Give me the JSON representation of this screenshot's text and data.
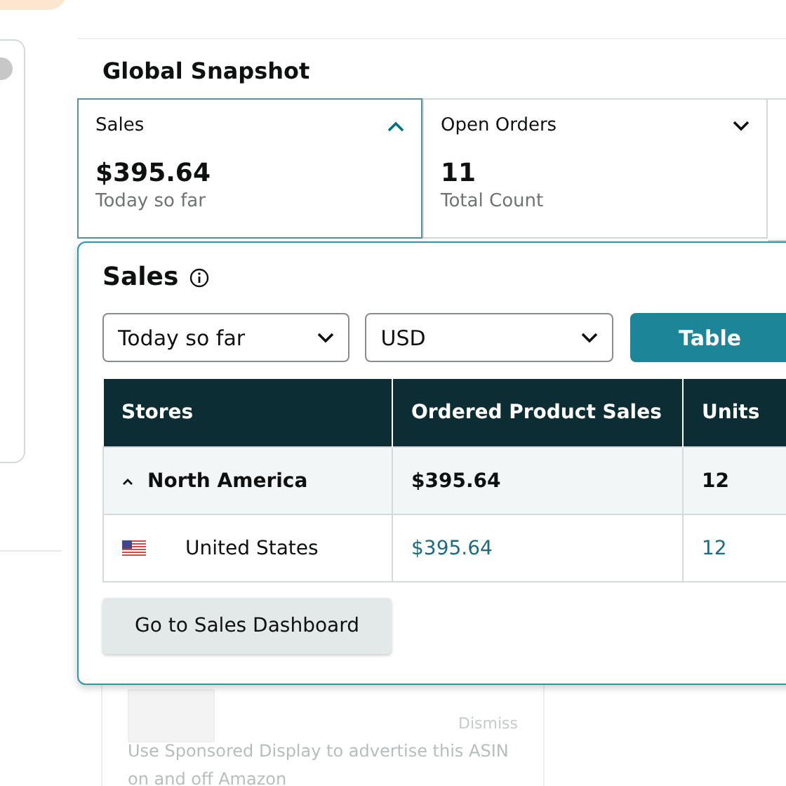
{
  "panel": {
    "title": "Global Snapshot"
  },
  "tiles": [
    {
      "label": "Sales",
      "value": "$395.64",
      "caption": "Today so far",
      "expanded": true
    },
    {
      "label": "Open Orders",
      "value": "11",
      "caption": "Total Count",
      "expanded": false
    }
  ],
  "popover": {
    "title": "Sales",
    "filters": [
      {
        "value": "Today so far"
      },
      {
        "value": "USD"
      }
    ],
    "view_button": "Table",
    "table": {
      "columns": [
        "Stores",
        "Ordered Product Sales",
        "Units"
      ],
      "rows": [
        {
          "kind": "group",
          "expanded": true,
          "cells": [
            "North America",
            "$395.64",
            "12"
          ]
        },
        {
          "kind": "store",
          "cells": [
            "United States",
            "$395.64",
            "12"
          ]
        }
      ]
    },
    "action": "Go to Sales Dashboard"
  },
  "promo": {
    "dismiss": "Dismiss",
    "text": "Use Sponsored Display to advertise this ASIN on and off Amazon"
  }
}
